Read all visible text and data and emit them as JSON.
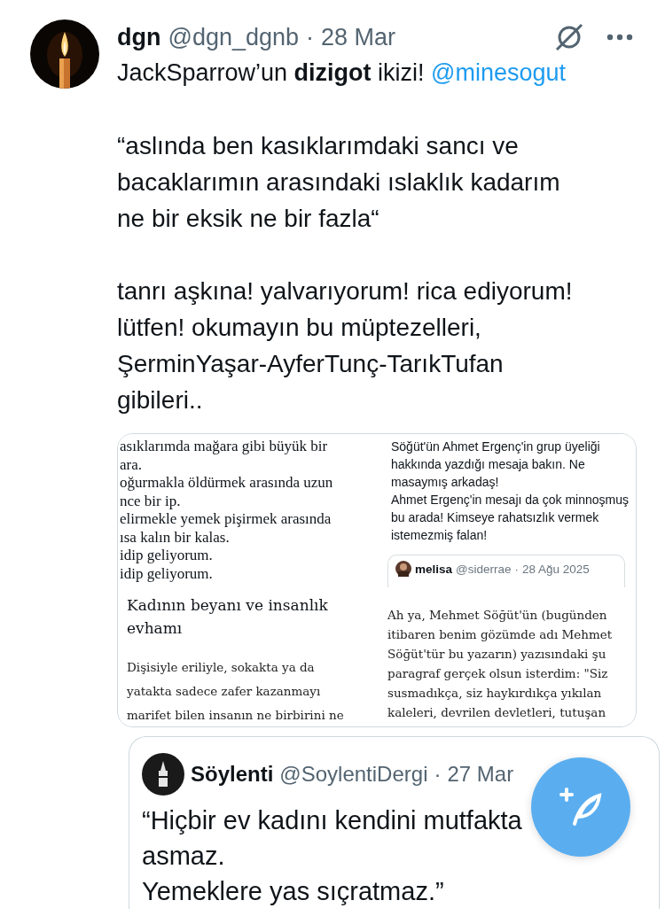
{
  "tweet": {
    "author_name": "dgn",
    "handle": "@dgn_dgnb",
    "separator": "·",
    "date": "28 Mar",
    "lead": {
      "text": "JackSparrow’un **dizigot** ikizi!",
      "mention": "@minesogut"
    },
    "paragraphs": [
      "“aslında ben kasıklarımdaki sancı ve\nbacaklarımın arasındaki ıslaklık kadarım\nne bir eksik ne bir fazla“",
      "tanrı aşkına! yalvarıyorum! rica ediyorum!\nlütfen! okumayın bu müptezelleri,\nŞerminYaşar-AyferTunç-TarıkTufan\ngibileri.."
    ],
    "media": [
      {
        "kind": "article",
        "poem_lines": [
          "asıklarımda mağara gibi büyük bir",
          "ara.",
          "oğurmakla öldürmek arasında uzun",
          "nce bir ip.",
          "elirmekle yemek pişirmek arasında",
          "ısa kalın bir kalas.",
          "idip geliyorum.",
          "idip geliyorum."
        ],
        "heading": "Kadının beyanı ve insanlık evhamı",
        "body": "Dişisiyle eriliyle, sokakta ya da\nyatakta sadece zafer kazanmayı\nmarifet bilen insanın ne birbirini ne"
      },
      {
        "kind": "post",
        "paragraphs": [
          "Söğüt'ün Ahmet Ergenç'in grup üyeliği hakkında yazdığı mesaja bakın. Ne masaymış arkadaş!",
          "Ahmet Ergenç'in mesajı da çok minnoşmuş bu arada! Kimseye rahatsızlık vermek istemezmiş falan!"
        ],
        "quote": {
          "author_name": "melisa",
          "handle": "@siderrae",
          "separator": "·",
          "date": "28 Ağu 2025"
        },
        "body": "Ah ya, Mehmet Söğüt'ün (bugünden\nitibaren benim gözümde adı Mehmet\nSöğüt'tür bu yazarın) yazısındaki şu\nparagraf gerçek olsun isterdim: \"Siz\nsusmadıkça, siz haykırdıkça yıkılan\nkaleleri, devrilen devletleri, tutuşan"
      }
    ]
  },
  "quoted_tweet": {
    "author_name": "Söylenti",
    "handle": "@SoylentiDergi",
    "separator": "·",
    "date": "27 Mar",
    "paragraphs": [
      "“Hiçbir ev kadını kendini mutfakta asmaz.",
      "Yemeklere yas sıçratmaz.”"
    ]
  }
}
